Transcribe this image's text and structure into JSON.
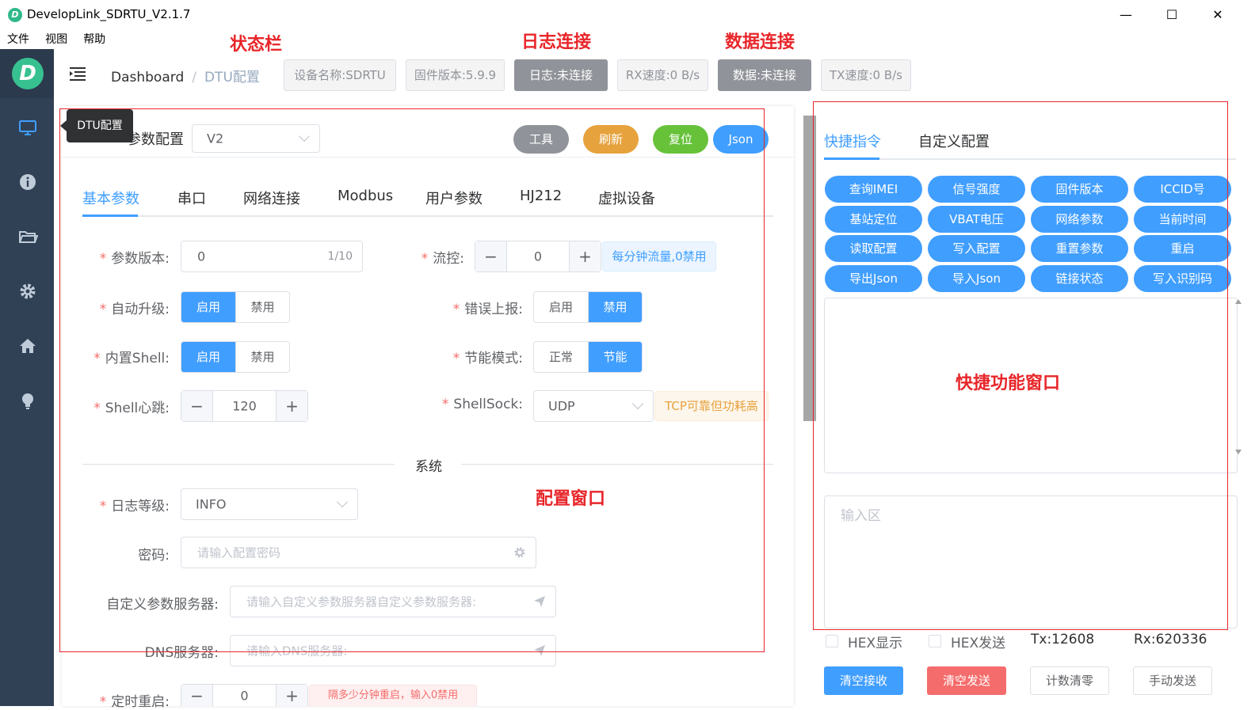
{
  "window": {
    "title": "DevelopLink_SDRTU_V2.1.7",
    "logo_letter": "D",
    "minimize": "—",
    "maximize": "☐",
    "close": "✕"
  },
  "menu": [
    "文件",
    "视图",
    "帮助"
  ],
  "annotations": {
    "status_bar": "状态栏",
    "log_conn": "日志连接",
    "data_conn": "数据连接",
    "config_window": "配置窗口",
    "quick_window": "快捷功能窗口"
  },
  "sidebar": {
    "logo_letter": "D",
    "icons": [
      "monitor-icon",
      "info-icon",
      "folder-icon",
      "gear-icon",
      "home-icon",
      "bulb-icon"
    ]
  },
  "header": {
    "breadcrumb": [
      "Dashboard",
      "DTU配置"
    ],
    "breadcrumb_sep": "/",
    "status": {
      "device_name": "设备名称:SDRTU",
      "firmware": "固件版本:5.9.9",
      "log": "日志:未连接",
      "rx_speed": "RX速度:0 B/s",
      "data": "数据:未连接",
      "tx_speed": "TX速度:0 B/s"
    }
  },
  "config": {
    "tooltip": "DTU配置",
    "title": "参数配置",
    "version_select": "V2",
    "buttons": {
      "tools": "工具",
      "refresh": "刷新",
      "reset": "复位",
      "json": "Json"
    },
    "colors": {
      "tools": "#909399",
      "refresh": "#e6a23c",
      "reset": "#67c23a",
      "json": "#409eff"
    },
    "tabs": [
      "基本参数",
      "串口",
      "网络连接",
      "Modbus",
      "用户参数",
      "HJ212",
      "虚拟设备"
    ],
    "active_tab": 0,
    "fields": {
      "param_version": {
        "label": "参数版本:",
        "value": "0",
        "count": "1/10"
      },
      "flow_ctrl": {
        "label": "流控:",
        "value": "0",
        "minus": "−",
        "plus": "+",
        "hint": "每分钟流量,0禁用"
      },
      "auto_upgrade": {
        "label": "自动升级:",
        "on": "启用",
        "off": "禁用"
      },
      "error_report": {
        "label": "错误上报:",
        "on": "启用",
        "off": "禁用"
      },
      "builtin_shell": {
        "label": "内置Shell:",
        "on": "启用",
        "off": "禁用"
      },
      "power_mode": {
        "label": "节能模式:",
        "on": "正常",
        "off": "节能"
      },
      "shell_heartbeat": {
        "label": "Shell心跳:",
        "value": "120",
        "minus": "−",
        "plus": "+"
      },
      "shell_sock": {
        "label": "ShellSock:",
        "value": "UDP",
        "hint": "TCP可靠但功耗高"
      },
      "system_divider": "系统",
      "log_level": {
        "label": "日志等级:",
        "value": "INFO"
      },
      "password": {
        "label": "密码:",
        "placeholder": "请输入配置密码"
      },
      "custom_server": {
        "label": "自定义参数服务器:",
        "placeholder": "请输入自定义参数服务器自定义参数服务器:"
      },
      "dns_server": {
        "label": "DNS服务器:",
        "placeholder": "请输入DNS服务器:"
      },
      "timed_restart": {
        "label": "定时重启:",
        "value": "0",
        "minus": "−",
        "plus": "+",
        "hint": "隔多少分钟重启，输入0禁用"
      }
    }
  },
  "quick": {
    "tabs": [
      "快捷指令",
      "自定义配置"
    ],
    "commands": [
      "查询IMEI",
      "信号强度",
      "固件版本",
      "ICCID号",
      "基站定位",
      "VBAT电压",
      "网络参数",
      "当前时间",
      "读取配置",
      "写入配置",
      "重置参数",
      "重启",
      "导出Json",
      "导入Json",
      "链接状态",
      "写入识别码"
    ],
    "input_placeholder": "输入区",
    "hex_display": "HEX显示",
    "hex_send": "HEX发送",
    "tx": "Tx:12608",
    "rx": "Rx:620336",
    "buttons": {
      "clear_recv": "清空接收",
      "clear_send": "清空发送",
      "reset_count": "计数清零",
      "manual_send": "手动发送"
    }
  }
}
